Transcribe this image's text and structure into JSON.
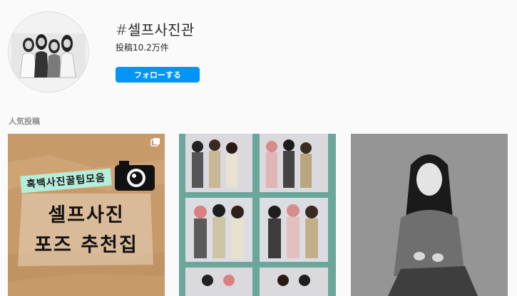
{
  "header": {
    "hashtag": "#셀프사진관",
    "post_count": "投稿10.2万件",
    "follow_label": "フォローする"
  },
  "section": {
    "title": "人気投稿"
  },
  "posts": [
    {
      "banner_text": "흑백사진꿀팁모음",
      "headline_line1": "셀프사진",
      "headline_line2": "포즈 추천집"
    },
    {},
    {}
  ],
  "colors": {
    "follow_button": "#0095f6",
    "background": "#fafafa",
    "teal_frame": "#6aa69a"
  }
}
